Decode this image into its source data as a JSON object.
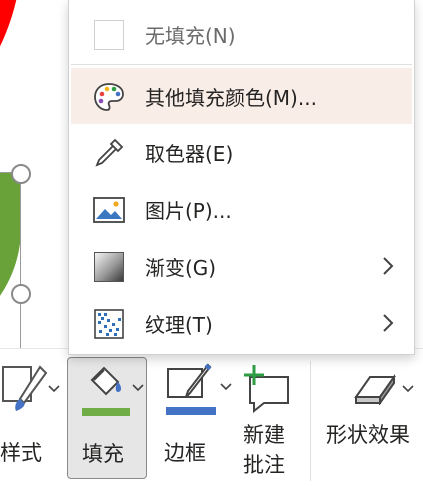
{
  "menu": {
    "items": [
      {
        "id": "no-fill",
        "label": "无填充(N)",
        "disabled": true
      },
      {
        "id": "more-colors",
        "label": "其他填充颜色(M)...",
        "hover": true
      },
      {
        "id": "eyedropper",
        "label": "取色器(E)"
      },
      {
        "id": "picture",
        "label": "图片(P)..."
      },
      {
        "id": "gradient",
        "label": "渐变(G)",
        "submenu": true
      },
      {
        "id": "texture",
        "label": "纹理(T)",
        "submenu": true
      }
    ]
  },
  "ribbon": {
    "style_label": "样式",
    "fill_label": "填充",
    "border_label": "边框",
    "new_comment_label_line1": "新建",
    "new_comment_label_line2": "批注",
    "shape_effects_label": "形状效果"
  },
  "colors": {
    "fill_bar": "#70ad47",
    "border_bar": "#4472c4",
    "hover_bg": "#f9ede8",
    "pie_red": "#ff0000",
    "pie_green": "#6aa23a"
  }
}
